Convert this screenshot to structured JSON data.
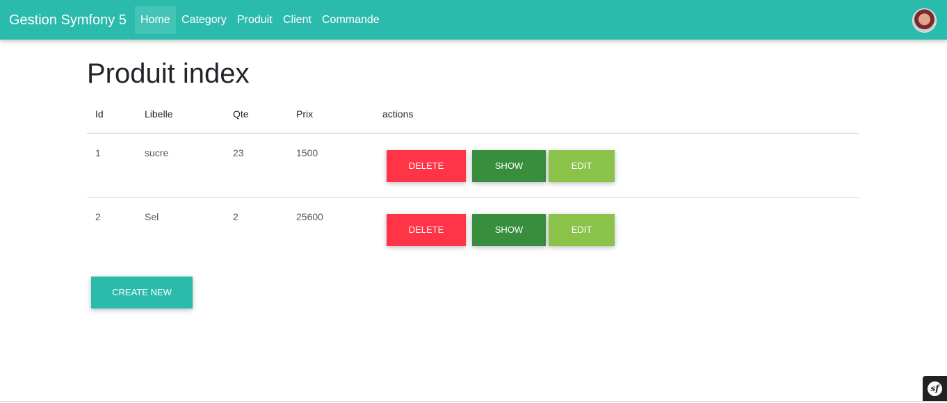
{
  "navbar": {
    "brand": "Gestion Symfony 5",
    "links": [
      "Home",
      "Category",
      "Produit",
      "Client",
      "Commande"
    ],
    "active": "Home"
  },
  "page": {
    "title": "Produit index"
  },
  "table": {
    "headers": [
      "Id",
      "Libelle",
      "Qte",
      "Prix",
      "actions"
    ],
    "rows": [
      {
        "id": "1",
        "libelle": "sucre",
        "qte": "23",
        "prix": "1500"
      },
      {
        "id": "2",
        "libelle": "Sel",
        "qte": "2",
        "prix": "25600"
      }
    ],
    "actions": {
      "delete": "Delete",
      "show": "Show",
      "edit": "Edit"
    }
  },
  "create_new": "Create new",
  "debug_toolbar": {
    "logo": "sf"
  },
  "colors": {
    "primary": "#2bbbad",
    "danger": "#ff3547",
    "show": "#388e3c",
    "edit": "#8bc34a"
  }
}
